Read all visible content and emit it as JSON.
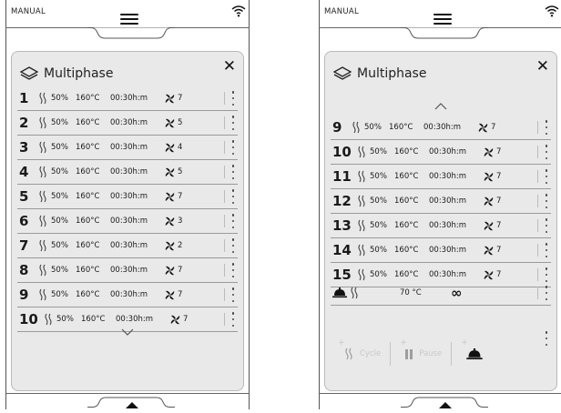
{
  "left": {
    "mode": "MANUAL",
    "title": "Multiphase",
    "close": "✕",
    "rows": [
      {
        "n": "1",
        "pct": "50%",
        "temp": "160°C",
        "time": "00:30h:m",
        "fan": "7"
      },
      {
        "n": "2",
        "pct": "50%",
        "temp": "160°C",
        "time": "00:30h:m",
        "fan": "5"
      },
      {
        "n": "3",
        "pct": "50%",
        "temp": "160°C",
        "time": "00:30h:m",
        "fan": "4"
      },
      {
        "n": "4",
        "pct": "50%",
        "temp": "160°C",
        "time": "00:30h:m",
        "fan": "5"
      },
      {
        "n": "5",
        "pct": "50%",
        "temp": "160°C",
        "time": "00:30h:m",
        "fan": "7"
      },
      {
        "n": "6",
        "pct": "50%",
        "temp": "160°C",
        "time": "00:30h:m",
        "fan": "3"
      },
      {
        "n": "7",
        "pct": "50%",
        "temp": "160°C",
        "time": "00:30h:m",
        "fan": "2"
      },
      {
        "n": "8",
        "pct": "50%",
        "temp": "160°C",
        "time": "00:30h:m",
        "fan": "7"
      },
      {
        "n": "9",
        "pct": "50%",
        "temp": "160°C",
        "time": "00:30h:m",
        "fan": "7"
      },
      {
        "n": "10",
        "pct": "50%",
        "temp": "160°C",
        "time": "00:30h:m",
        "fan": "7"
      }
    ]
  },
  "right": {
    "mode": "MANUAL",
    "title": "Multiphase",
    "close": "✕",
    "rows": [
      {
        "n": "9",
        "pct": "50%",
        "temp": "160°C",
        "time": "00:30h:m",
        "fan": "7"
      },
      {
        "n": "10",
        "pct": "50%",
        "temp": "160°C",
        "time": "00:30h:m",
        "fan": "7"
      },
      {
        "n": "11",
        "pct": "50%",
        "temp": "160°C",
        "time": "00:30h:m",
        "fan": "7"
      },
      {
        "n": "12",
        "pct": "50%",
        "temp": "160°C",
        "time": "00:30h:m",
        "fan": "7"
      },
      {
        "n": "13",
        "pct": "50%",
        "temp": "160°C",
        "time": "00:30h:m",
        "fan": "7"
      },
      {
        "n": "14",
        "pct": "50%",
        "temp": "160°C",
        "time": "00:30h:m",
        "fan": "7"
      },
      {
        "n": "15",
        "pct": "50%",
        "temp": "160°C",
        "time": "00:30h:m",
        "fan": "7"
      }
    ],
    "special": {
      "temp": "70 °C",
      "duration": "∞"
    },
    "actions": {
      "cycle": "Cycle",
      "pause": "Pause",
      "plus": "+"
    }
  },
  "icons": [
    "wifi-icon",
    "menu-icon",
    "layers-icon",
    "close-icon",
    "heat-icon",
    "fan-icon",
    "more-icon",
    "chevron-up-icon",
    "chevron-down-icon",
    "dome-icon",
    "infinity-icon",
    "pause-icon",
    "triangle-up-icon"
  ]
}
